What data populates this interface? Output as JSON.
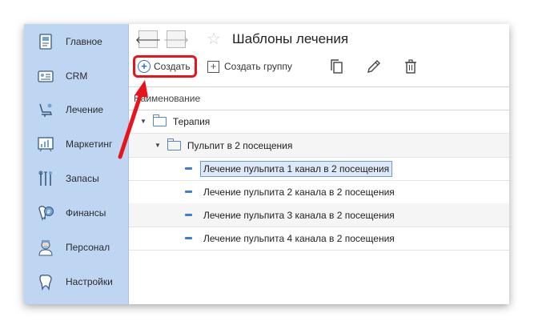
{
  "sidebar": {
    "items": [
      {
        "label": "Главное",
        "icon": "home-document-icon"
      },
      {
        "label": "CRM",
        "icon": "crm-card-icon"
      },
      {
        "label": "Лечение",
        "icon": "dental-chair-icon"
      },
      {
        "label": "Маркетинг",
        "icon": "marketing-chart-icon"
      },
      {
        "label": "Запасы",
        "icon": "dental-tools-icon"
      },
      {
        "label": "Финансы",
        "icon": "tooth-coin-icon"
      },
      {
        "label": "Персонал",
        "icon": "doctor-icon"
      },
      {
        "label": "Настройки",
        "icon": "tooth-settings-icon"
      }
    ]
  },
  "header": {
    "back_glyph": "🡐",
    "forward_glyph": "🡒",
    "star_glyph": "☆",
    "title": "Шаблоны лечения"
  },
  "toolbar": {
    "create_label": "Создать",
    "create_group_label": "Создать группу"
  },
  "table": {
    "column_header": "Наименование",
    "rows": [
      {
        "level": 0,
        "type": "group",
        "label": "Терапия"
      },
      {
        "level": 1,
        "type": "group",
        "label": "Пульпит в 2 посещения"
      },
      {
        "level": 2,
        "type": "item",
        "label": "Лечение пульпита 1 канал в 2 посещения",
        "selected": true
      },
      {
        "level": 2,
        "type": "item",
        "label": "Лечение пульпита 2 канала в 2 посещения"
      },
      {
        "level": 2,
        "type": "item",
        "label": "Лечение пульпита 3 канала в 2 посещения"
      },
      {
        "level": 2,
        "type": "item",
        "label": "Лечение пульпита 4 канала в 2 посещения"
      }
    ]
  },
  "colors": {
    "sidebar_bg": "#bed6f2",
    "highlight_red": "#e8141c",
    "accent_blue": "#2d6fbf"
  }
}
